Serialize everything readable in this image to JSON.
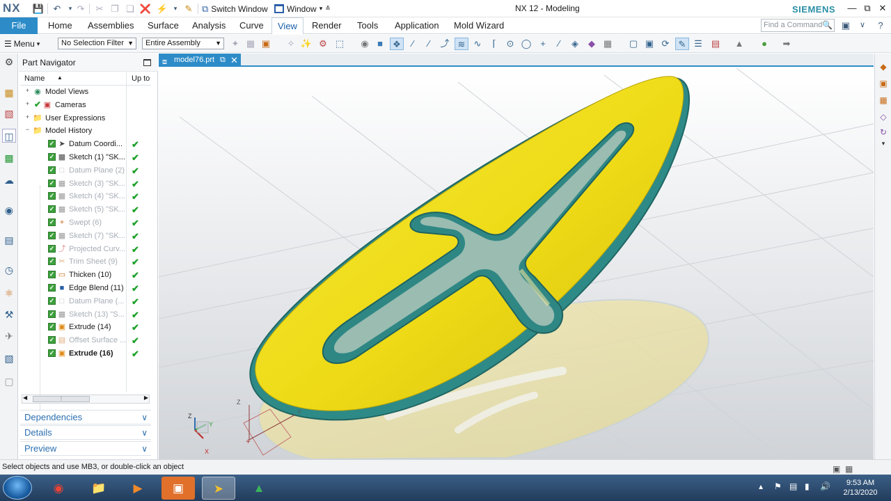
{
  "titlebar": {
    "logo": "NX",
    "switch_window": "Switch Window",
    "window_menu": "Window",
    "app_title": "NX 12 - Modeling",
    "brand": "SIEMENS"
  },
  "ribbon": {
    "file": "File",
    "tabs": [
      "Home",
      "Assemblies",
      "Surface",
      "Analysis",
      "Curve",
      "View",
      "Render",
      "Tools",
      "Application",
      "Mold Wizard"
    ],
    "active_tab": "View",
    "find_placeholder": "Find a Command"
  },
  "selection_bar": {
    "menu": "Menu",
    "filter": "No Selection Filter",
    "scope": "Entire Assembly"
  },
  "navigator": {
    "title": "Part Navigator",
    "col_name": "Name",
    "col_upto": "Up to",
    "top_items": [
      {
        "label": "Model Views",
        "icon": "model-views-icon",
        "exp": "+"
      },
      {
        "label": "Cameras",
        "icon": "camera-icon",
        "exp": "+"
      },
      {
        "label": "User Expressions",
        "icon": "folder-icon",
        "exp": "+"
      },
      {
        "label": "Model History",
        "icon": "folder-icon",
        "exp": "−"
      }
    ],
    "history": [
      {
        "label": "Datum Coordi...",
        "icon": "datum-csys-icon",
        "state": "normal"
      },
      {
        "label": "Sketch (1) \"SK...",
        "icon": "sketch-icon",
        "state": "normal"
      },
      {
        "label": "Datum Plane (2)",
        "icon": "datum-plane-icon",
        "state": "dim"
      },
      {
        "label": "Sketch (3) \"SK...",
        "icon": "sketch-icon",
        "state": "dim"
      },
      {
        "label": "Sketch (4) \"SK...",
        "icon": "sketch-icon",
        "state": "dim"
      },
      {
        "label": "Sketch (5) \"SK...",
        "icon": "sketch-icon",
        "state": "dim"
      },
      {
        "label": "Swept (6)",
        "icon": "swept-icon",
        "state": "dim"
      },
      {
        "label": "Sketch (7) \"SK...",
        "icon": "sketch-icon",
        "state": "dim"
      },
      {
        "label": "Projected Curv...",
        "icon": "projected-curve-icon",
        "state": "dim"
      },
      {
        "label": "Trim Sheet (9)",
        "icon": "trim-sheet-icon",
        "state": "dim"
      },
      {
        "label": "Thicken (10)",
        "icon": "thicken-icon",
        "state": "normal"
      },
      {
        "label": "Edge Blend (11)",
        "icon": "edge-blend-icon",
        "state": "normal"
      },
      {
        "label": "Datum Plane (...",
        "icon": "datum-plane-icon",
        "state": "dim"
      },
      {
        "label": "Sketch (13) \"S...",
        "icon": "sketch-icon",
        "state": "dim"
      },
      {
        "label": "Extrude (14)",
        "icon": "extrude-icon",
        "state": "normal"
      },
      {
        "label": "Offset Surface ...",
        "icon": "offset-surface-icon",
        "state": "dim"
      },
      {
        "label": "Extrude (16)",
        "icon": "extrude-icon",
        "state": "bold"
      }
    ],
    "panels": [
      "Dependencies",
      "Details",
      "Preview"
    ]
  },
  "graphics": {
    "tab": "model76.prt",
    "axis_labels": {
      "x": "X",
      "y": "Y",
      "z": "Z"
    }
  },
  "status": "Select objects and use MB3, or double-click an object",
  "taskbar": {
    "time": "9:53 AM",
    "date": "2/13/2020"
  },
  "colors": {
    "accent": "#2d8cc8",
    "part_yellow": "#f1e01a",
    "part_edge": "#2f8a86",
    "check_green": "#1da12a"
  }
}
